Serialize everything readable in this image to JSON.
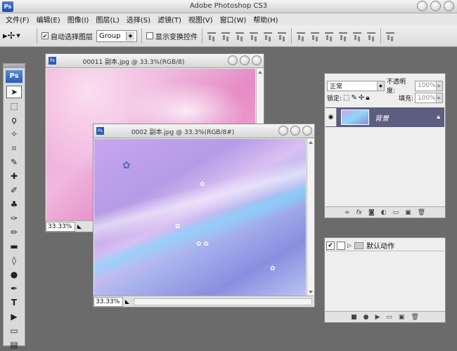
{
  "app": {
    "title": "Adobe Photoshop CS3",
    "logo": "Ps"
  },
  "menu": [
    "文件(F)",
    "编辑(E)",
    "图像(I)",
    "图层(L)",
    "选择(S)",
    "滤镜(T)",
    "视图(V)",
    "窗口(W)",
    "帮助(H)"
  ],
  "options": {
    "auto_select_label": "自动选择图层",
    "auto_select_checked": true,
    "group_value": "Group",
    "show_transform_label": "显示变换控件",
    "show_transform_checked": false
  },
  "toolbox": {
    "logo": "Ps"
  },
  "doc1": {
    "title": "00011 副本.jpg @ 33.3%(RGB/8)",
    "zoom": "33.33%"
  },
  "doc2": {
    "title": "0002 副本.jpg @ 33.3%(RGB/8#)",
    "zoom": "33.33%"
  },
  "layers_panel": {
    "blend_mode": "正常",
    "opacity_label": "不透明度:",
    "opacity_value": "100%",
    "lock_label": "锁定:",
    "fill_label": "填充:",
    "fill_value": "100%",
    "layer_name": "背景"
  },
  "actions_panel": {
    "set_name": "默认动作"
  }
}
